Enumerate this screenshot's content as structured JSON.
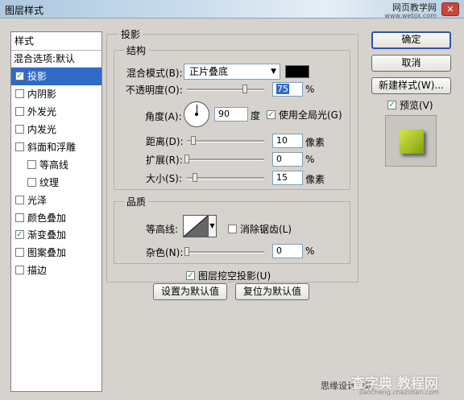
{
  "window": {
    "title": "图层样式",
    "close": "✕"
  },
  "watermark_top": {
    "line1": "网页教学网",
    "line2": "www.webjx.com"
  },
  "sidebar": {
    "header": "样式",
    "blend_options": "混合选项:默认",
    "items": [
      {
        "label": "投影",
        "checked": true,
        "selected": true,
        "sub": false
      },
      {
        "label": "内阴影",
        "checked": false,
        "selected": false,
        "sub": false
      },
      {
        "label": "外发光",
        "checked": false,
        "selected": false,
        "sub": false
      },
      {
        "label": "内发光",
        "checked": false,
        "selected": false,
        "sub": false
      },
      {
        "label": "斜面和浮雕",
        "checked": false,
        "selected": false,
        "sub": false
      },
      {
        "label": "等高线",
        "checked": false,
        "selected": false,
        "sub": true
      },
      {
        "label": "纹理",
        "checked": false,
        "selected": false,
        "sub": true
      },
      {
        "label": "光泽",
        "checked": false,
        "selected": false,
        "sub": false
      },
      {
        "label": "颜色叠加",
        "checked": false,
        "selected": false,
        "sub": false
      },
      {
        "label": "渐变叠加",
        "checked": true,
        "selected": false,
        "sub": false
      },
      {
        "label": "图案叠加",
        "checked": false,
        "selected": false,
        "sub": false
      },
      {
        "label": "描边",
        "checked": false,
        "selected": false,
        "sub": false
      }
    ]
  },
  "drop_shadow": {
    "title": "投影",
    "structure": {
      "title": "结构",
      "blend_mode_label": "混合模式(B):",
      "blend_mode_value": "正片叠底",
      "blend_color": "#000000",
      "opacity_label": "不透明度(O):",
      "opacity_value": "75",
      "opacity_level": 0.75,
      "percent": "%",
      "angle_label": "角度(A):",
      "angle_value": "90",
      "angle_unit": "度",
      "global_light_label": "使用全局光(G)",
      "global_light_checked": true,
      "distance_label": "距离(D):",
      "distance_value": "10",
      "spread_label": "扩展(R):",
      "spread_value": "0",
      "size_label": "大小(S):",
      "size_value": "15",
      "pixel_unit": "像素"
    },
    "quality": {
      "title": "品质",
      "contour_label": "等高线:",
      "antialias_label": "消除锯齿(L)",
      "antialias_checked": false,
      "noise_label": "杂色(N):",
      "noise_value": "0",
      "percent": "%"
    },
    "knockout_label": "图层挖空投影(U)",
    "knockout_checked": true,
    "make_default": "设置为默认值",
    "reset_default": "复位为默认值"
  },
  "buttons": {
    "ok": "确定",
    "cancel": "取消",
    "new_style": "新建样式(W)...",
    "preview_label": "预览(V)",
    "preview_checked": true
  },
  "footer_watermark": {
    "text1": "思缘设计论坛",
    "text2": "查字典 教程网",
    "text3": "jiaocheng.chazidian.com"
  }
}
